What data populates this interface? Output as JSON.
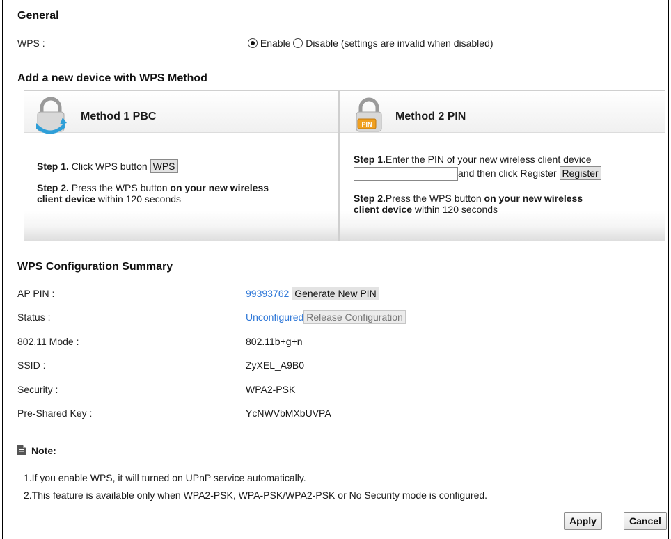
{
  "general": {
    "title": "General",
    "wps_label": "WPS :",
    "enable_label": "Enable",
    "disable_label": "Disable (settings are invalid when disabled)",
    "selected": "Enable"
  },
  "add_device": {
    "title": "Add a new device with WPS Method",
    "method1": {
      "title": "Method 1 PBC",
      "icon": "lock-refresh-icon",
      "step1_bold": "Step 1.",
      "step1_text": " Click WPS button ",
      "wps_button": "WPS",
      "step2_bold": "Step 2.",
      "step2_text1": " Press the WPS button ",
      "step2_bold2": "on your new wireless",
      "step2_bold3": "client device",
      "step2_text2": " within 120 seconds"
    },
    "method2": {
      "title": "Method 2 PIN",
      "icon": "lock-pin-icon",
      "pin_badge": "PIN",
      "step1_bold": "Step 1.",
      "step1_text": "Enter the PIN of your new wireless client device",
      "pin_value": "",
      "step1_text2": "and then click Register",
      "register_button": "Register",
      "step2_bold": "Step 2.",
      "step2_text1": "Press the WPS button ",
      "step2_bold2": "on your new wireless",
      "step2_bold3": "client device",
      "step2_text2": " within 120 seconds"
    }
  },
  "summary": {
    "title": "WPS Configuration Summary",
    "ap_pin_label": "AP PIN :",
    "ap_pin_value": "99393762",
    "generate_button": "Generate New PIN",
    "status_label": "Status :",
    "status_value": "Unconfigured",
    "release_button": "Release Configuration",
    "mode_label": "802.11 Mode :",
    "mode_value": "802.11b+g+n",
    "ssid_label": "SSID :",
    "ssid_value": "ZyXEL_A9B0",
    "security_label": "Security :",
    "security_value": "WPA2-PSK",
    "psk_label": "Pre-Shared Key :",
    "psk_value": "YcNWVbMXbUVPA"
  },
  "note": {
    "title": "Note:",
    "icon": "note-icon",
    "line1": "1.If you enable WPS, it will turned on UPnP service automatically.",
    "line2": "2.This feature is available only when WPA2-PSK, WPA-PSK/WPA2-PSK or No Security mode is configured."
  },
  "actions": {
    "apply": "Apply",
    "cancel": "Cancel"
  },
  "colors": {
    "link": "#2f78d8",
    "pin_badge": "#f0a020"
  }
}
